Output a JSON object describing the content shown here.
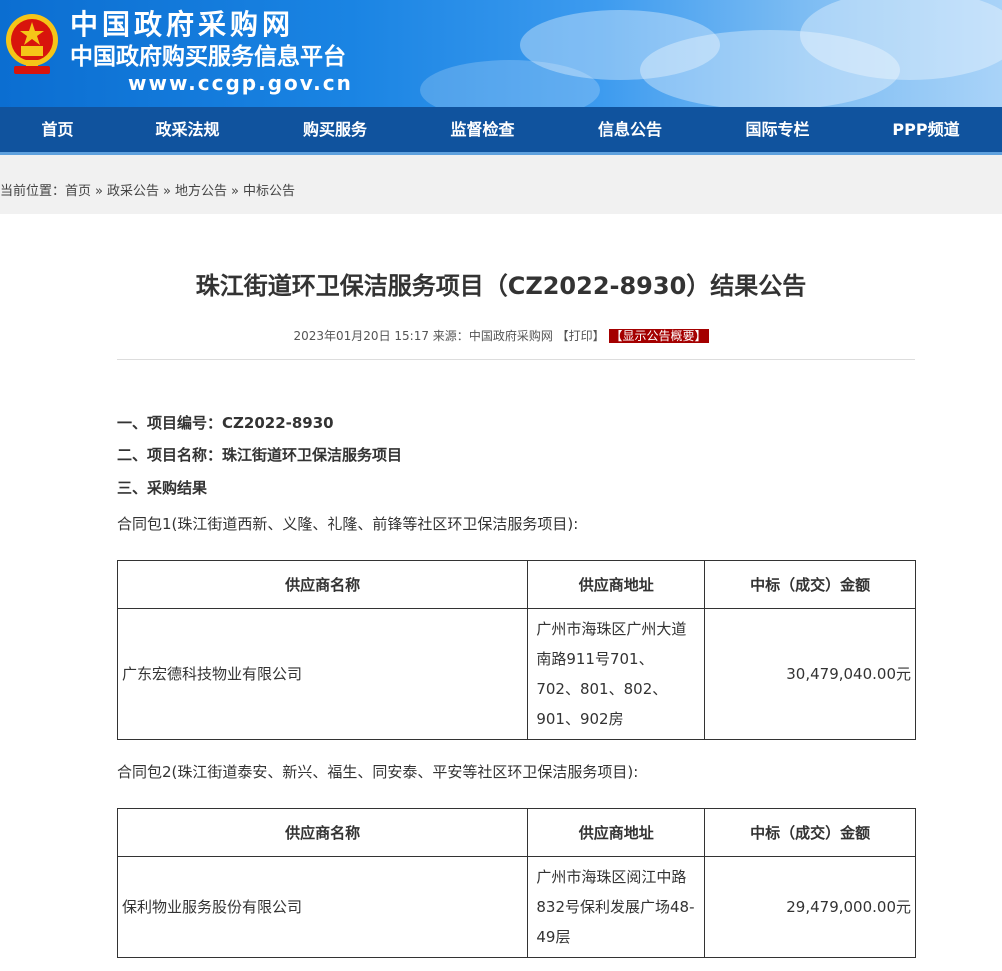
{
  "header": {
    "title": "中国政府采购网",
    "subtitle": "中国政府购买服务信息平台",
    "url": "www.ccgp.gov.cn"
  },
  "nav": [
    "首页",
    "政采法规",
    "购买服务",
    "监督检查",
    "信息公告",
    "国际专栏",
    "PPP频道"
  ],
  "breadcrumb": {
    "prefix": "当前位置：",
    "items": [
      "首页",
      "政采公告",
      "地方公告",
      "中标公告"
    ],
    "separator": "»"
  },
  "article": {
    "title": "珠江街道环卫保洁服务项目（CZ2022-8930）结果公告",
    "date": "2023年01月20日 15:17",
    "source_label": "来源：",
    "source": "中国政府采购网",
    "print": "【打印】",
    "summary": "【显示公告概要】",
    "line1_label": "一、项目编号：",
    "line1_value": "CZ2022-8930",
    "line2_label": "二、项目名称：",
    "line2_value": "珠江街道环卫保洁服务项目",
    "line3": "三、采购结果",
    "table_headers": [
      "供应商名称",
      "供应商地址",
      "中标（成交）金额"
    ],
    "packages": [
      {
        "label": "合同包1(珠江街道西新、义隆、礼隆、前锋等社区环卫保洁服务项目):",
        "supplier": "广东宏德科技物业有限公司",
        "address": "广州市海珠区广州大道南路911号701、702、801、802、901、902房",
        "amount": "30,479,040.00元"
      },
      {
        "label": "合同包2(珠江街道泰安、新兴、福生、同安泰、平安等社区环卫保洁服务项目):",
        "supplier": "保利物业服务股份有限公司",
        "address": "广州市海珠区阅江中路832号保利发展广场48-49层",
        "amount": "29,479,000.00元"
      }
    ]
  }
}
